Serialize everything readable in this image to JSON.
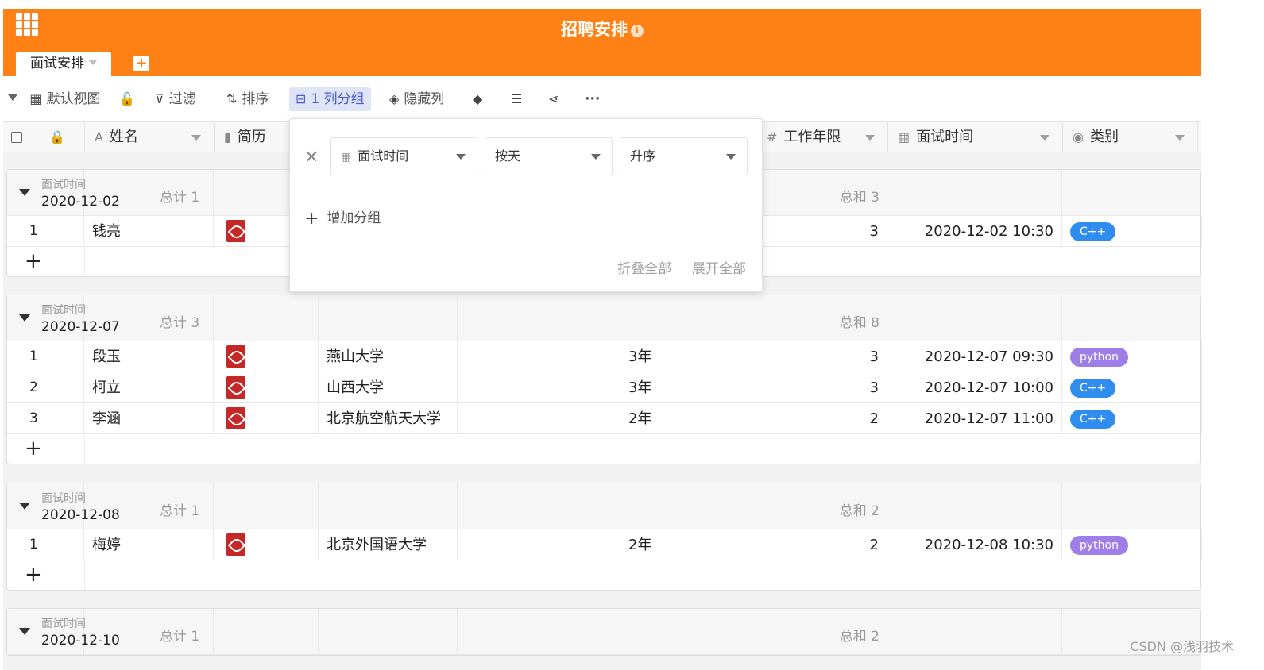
{
  "header": {
    "title": "招聘安排",
    "active_tab": "面试安排",
    "add_tab": "+"
  },
  "toolbar": {
    "view": "默认视图",
    "filter": "过滤",
    "sort": "排序",
    "group": "1 列分组",
    "hide": "隐藏列",
    "more": "···"
  },
  "columns": [
    "姓名",
    "简历",
    "工作年限",
    "面试时间",
    "类别"
  ],
  "group_popup": {
    "field": "面试时间",
    "granularity": "按天",
    "order": "升序",
    "add_group": "增加分组",
    "collapse_all": "折叠全部",
    "expand_all": "展开全部"
  },
  "groups": [
    {
      "field": "面试时间",
      "value": "2020-12-02",
      "count": "总计 1",
      "sum": "总和 3",
      "rows": [
        {
          "idx": "1",
          "name": "钱亮",
          "school": "",
          "years_text": "",
          "years": "3",
          "time": "2020-12-02 10:30",
          "category": "C++",
          "badge": "cpp"
        }
      ]
    },
    {
      "field": "面试时间",
      "value": "2020-12-07",
      "count": "总计 3",
      "sum": "总和 8",
      "rows": [
        {
          "idx": "1",
          "name": "段玉",
          "school": "燕山大学",
          "years_text": "3年",
          "years": "3",
          "time": "2020-12-07 09:30",
          "category": "python",
          "badge": "py"
        },
        {
          "idx": "2",
          "name": "柯立",
          "school": "山西大学",
          "years_text": "3年",
          "years": "3",
          "time": "2020-12-07 10:00",
          "category": "C++",
          "badge": "cpp"
        },
        {
          "idx": "3",
          "name": "李涵",
          "school": "北京航空航天大学",
          "years_text": "2年",
          "years": "2",
          "time": "2020-12-07 11:00",
          "category": "C++",
          "badge": "cpp"
        }
      ]
    },
    {
      "field": "面试时间",
      "value": "2020-12-08",
      "count": "总计 1",
      "sum": "总和 2",
      "rows": [
        {
          "idx": "1",
          "name": "梅婷",
          "school": "北京外国语大学",
          "years_text": "2年",
          "years": "2",
          "time": "2020-12-08 10:30",
          "category": "python",
          "badge": "py"
        }
      ]
    },
    {
      "field": "面试时间",
      "value": "2020-12-10",
      "count": "总计 1",
      "sum": "总和 2",
      "rows": []
    }
  ],
  "watermark": "CSDN @浅羽技术",
  "colors": {
    "header": "#ff8014",
    "cpp": "#2f8df0",
    "python": "#9f7ee8",
    "active": "#4a5bd4"
  }
}
